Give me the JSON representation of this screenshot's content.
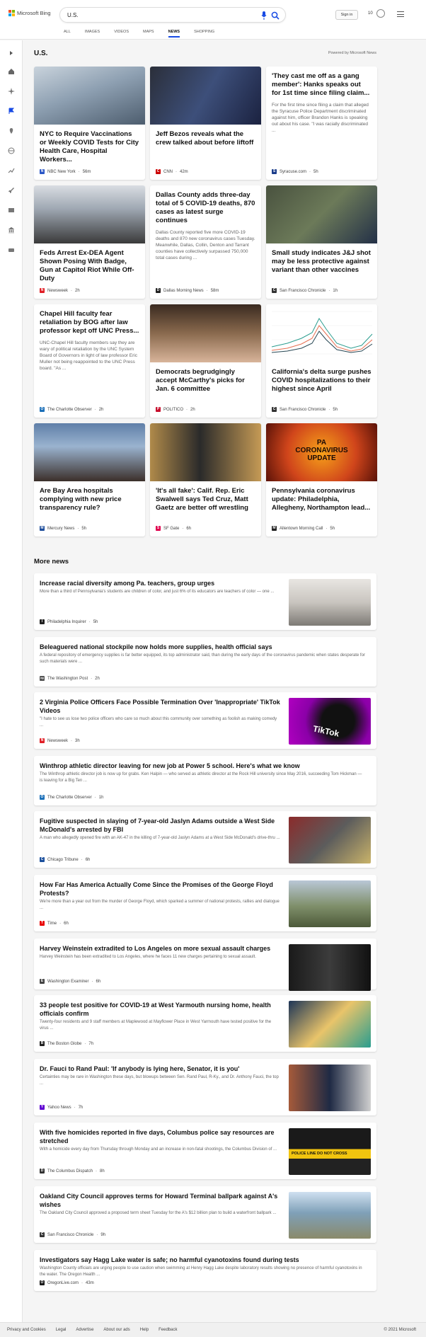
{
  "header": {
    "brand": "Microsoft Bing",
    "query": "U.S.",
    "signin_label": "Sign in",
    "rewards_count": "10",
    "tabs": [
      "ALL",
      "IMAGES",
      "VIDEOS",
      "MAPS",
      "NEWS",
      "SHOPPING"
    ],
    "active_tab": "NEWS",
    "accent_color": "#174ae4"
  },
  "section": {
    "title": "U.S.",
    "powered_by": "Powered by Microsoft News"
  },
  "cards": [
    {
      "title": "NYC to Require Vaccinations or Weekly COVID Tests for City Health Care, Hospital Workers...",
      "snippet": "",
      "source": "NBC New York",
      "time": "56m",
      "icon": "N",
      "icon_color": "#2a56c6",
      "has_image": true
    },
    {
      "title": "Jeff Bezos reveals what the crew talked about before liftoff",
      "snippet": "",
      "source": "CNN",
      "time": "42m",
      "icon": "C",
      "icon_color": "#cc0000",
      "has_image": true
    },
    {
      "title": "'They cast me off as a gang member': Hanks speaks out for 1st time since filing claim...",
      "snippet": "For the first time since filing a claim that alleged the Syracuse Police Department discriminated against him, officer Brandon Hanks is speaking out about his case. \"I was racially discriminated ...",
      "source": "Syracuse.com",
      "time": "5h",
      "icon": "S",
      "icon_color": "#1a3c8a",
      "has_image": false
    },
    {
      "title": "Feds Arrest Ex-DEA Agent Shown Posing With Badge, Gun at Capitol Riot While Off-Duty",
      "snippet": "",
      "source": "Newsweek",
      "time": "2h",
      "icon": "N",
      "icon_color": "#e01f26",
      "has_image": true
    },
    {
      "title": "Dallas County adds three-day total of 5 COVID-19 deaths, 870 cases as latest surge continues",
      "snippet": "Dallas County reported five more COVID-19 deaths and 870 new coronavirus cases Tuesday. Meanwhile, Dallas, Collin, Denton and Tarrant counties have collectively surpassed 750,000 total cases during ...",
      "source": "Dallas Morning News",
      "time": "58m",
      "icon": "D",
      "icon_color": "#222222",
      "has_image": false
    },
    {
      "title": "Small study indicates J&J shot may be less protective against variant than other vaccines",
      "snippet": "",
      "source": "San Francisco Chronicle",
      "time": "1h",
      "icon": "C",
      "icon_color": "#333333",
      "has_image": true
    },
    {
      "title": "Chapel Hill faculty fear retaliation by BOG after law professor kept off UNC Press...",
      "snippet": "UNC-Chapel Hill faculty members say they are wary of political retaliation by the UNC System Board of Governors in light of law professor Eric Muller not being reappointed to the UNC Press board. \"As ...",
      "source": "The Charlotte Observer",
      "time": "2h",
      "icon": "O",
      "icon_color": "#1b6fb8",
      "has_image": false
    },
    {
      "title": "Democrats begrudgingly accept McCarthy's picks for Jan. 6 committee",
      "snippet": "",
      "source": "POLITICO",
      "time": "2h",
      "icon": "P",
      "icon_color": "#c8102e",
      "has_image": true
    },
    {
      "title": "California's delta surge pushes COVID hospitalizations to their highest since April",
      "snippet": "",
      "source": "San Francisco Chronicle",
      "time": "5h",
      "icon": "C",
      "icon_color": "#333333",
      "has_image": true
    },
    {
      "title": "Are Bay Area hospitals complying with new price transparency rule?",
      "snippet": "",
      "source": "Mercury News",
      "time": "5h",
      "icon": "M",
      "icon_color": "#1f4e9b",
      "has_image": true
    },
    {
      "title": "'It's all fake': Calif. Rep. Eric Swalwell says Ted Cruz, Matt Gaetz are better off wrestling",
      "snippet": "",
      "source": "SF Gate",
      "time": "6h",
      "icon": "S",
      "icon_color": "#e0004d",
      "has_image": true
    },
    {
      "title": "Pennsylvania coronavirus update: Philadelphia, Allegheny, Northampton lead...",
      "snippet": "",
      "source": "Allentown Morning Call",
      "time": "5h",
      "icon": "M",
      "icon_color": "#222222",
      "has_image": true
    }
  ],
  "pa_banner": {
    "line1": "PA",
    "line2": "CORONAVIRUS",
    "line3": "UPDATE"
  },
  "more_news": {
    "title": "More news",
    "items": [
      {
        "title": "Increase racial diversity among Pa. teachers, group urges",
        "snippet": "More than a third of Pennsylvania's students are children of color, and just 6% of its educators are teachers of color — one ...",
        "source": "Philadelphia Inquirer",
        "time": "5h",
        "icon": "I",
        "icon_color": "#222222"
      },
      {
        "title": "Beleaguered national stockpile now holds more supplies, health official says",
        "snippet": "A federal repository of emergency supplies is far better equipped, its top administrator said, than during the early days of the coronavirus pandemic when states desperate for such materials were ...",
        "source": "The Washington Post",
        "time": "2h",
        "icon": "wp",
        "icon_color": "#555555"
      },
      {
        "title": "2 Virginia Police Officers Face Possible Termination Over 'Inappropriate' TikTok Videos",
        "snippet": "\"I hate to see us lose two police officers who care so much about this community over something as foolish as making comedy ...",
        "source": "Newsweek",
        "time": "3h",
        "icon": "N",
        "icon_color": "#e01f26"
      },
      {
        "title": "Winthrop athletic director leaving for new job at Power 5 school. Here's what we know",
        "snippet": "The Winthrop athletic director job is now up for grabs. Ken Halpin — who served as athletic director at the Rock Hill university since May 2016, succeeding Tom Hickman — is leaving for a Big Ten ...",
        "source": "The Charlotte Observer",
        "time": "1h",
        "icon": "O",
        "icon_color": "#1b6fb8"
      },
      {
        "title": "Fugitive suspected in slaying of 7-year-old Jaslyn Adams outside a West Side McDonald's arrested by FBI",
        "snippet": "A man who allegedly opened fire with an AK-47 in the killing of 7-year-old Jaslyn Adams at a West Side McDonald's drive-thru ...",
        "source": "Chicago Tribune",
        "time": "6h",
        "icon": "C",
        "icon_color": "#1b4f9c"
      },
      {
        "title": "How Far Has America Actually Come Since the Promises of the George Floyd Protests?",
        "snippet": "We're more than a year out from the murder of George Floyd, which sparked a summer of national protests, rallies and dialogue ...",
        "source": "Time",
        "time": "6h",
        "icon": "T",
        "icon_color": "#e90606"
      },
      {
        "title": "Harvey Weinstein extradited to Los Angeles on more sexual assault charges",
        "snippet": "Harvey Weinstein has been extradited to Los Angeles, where he faces 11 new charges pertaining to sexual assault.",
        "source": "Washington Examiner",
        "time": "6h",
        "icon": "E",
        "icon_color": "#444444"
      },
      {
        "title": "33 people test positive for COVID-19 at West Yarmouth nursing home, health officials confirm",
        "snippet": "Twenty-four residents and 9 staff members at Maplewood at Mayflower Place in West Yarmouth have tested positive for the virus ...",
        "source": "The Boston Globe",
        "time": "7h",
        "icon": "B",
        "icon_color": "#222222"
      },
      {
        "title": "Dr. Fauci to Rand Paul: 'If anybody is lying here, Senator, it is you'",
        "snippet": "Certainties may be rare in Washington these days, but blowups between Sen. Rand Paul, R-Ky., and Dr. Anthony Fauci, the top ...",
        "source": "Yahoo News",
        "time": "7h",
        "icon": "Y",
        "icon_color": "#6001d2"
      },
      {
        "title": "With five homicides reported in five days, Columbus police say resources are stretched",
        "snippet": "With a homicide every day from Thursday through Monday and an increase in non-fatal shootings, the Columbus Division of ...",
        "source": "The Columbus Dispatch",
        "time": "8h",
        "icon": "D",
        "icon_color": "#333333"
      },
      {
        "title": "Oakland City Council approves terms for Howard Terminal ballpark against A's wishes",
        "snippet": "The Oakland City Council approved a proposed term sheet Tuesday for the A's $12 billion plan to build a waterfront ballpark ...",
        "source": "San Francisco Chronicle",
        "time": "9h",
        "icon": "C",
        "icon_color": "#333333"
      },
      {
        "title": "Investigators say Hagg Lake water is safe; no harmful cyanotoxins found during tests",
        "snippet": "Washington County officials are urging people to use caution when swimming at Henry Hagg Lake despite laboratory results showing no presence of harmful cyanotoxins in the water. The Oregon Health ...",
        "source": "OregonLive.com",
        "time": "43m",
        "icon": "O",
        "icon_color": "#1a1a1a"
      }
    ]
  },
  "tiktok_label": "TikTok",
  "police_tape_text": "POLICE LINE DO NOT CROSS",
  "footer": {
    "links": [
      "Privacy and Cookies",
      "Legal",
      "Advertise",
      "About our ads",
      "Help",
      "Feedback"
    ],
    "copyright": "© 2021 Microsoft"
  }
}
